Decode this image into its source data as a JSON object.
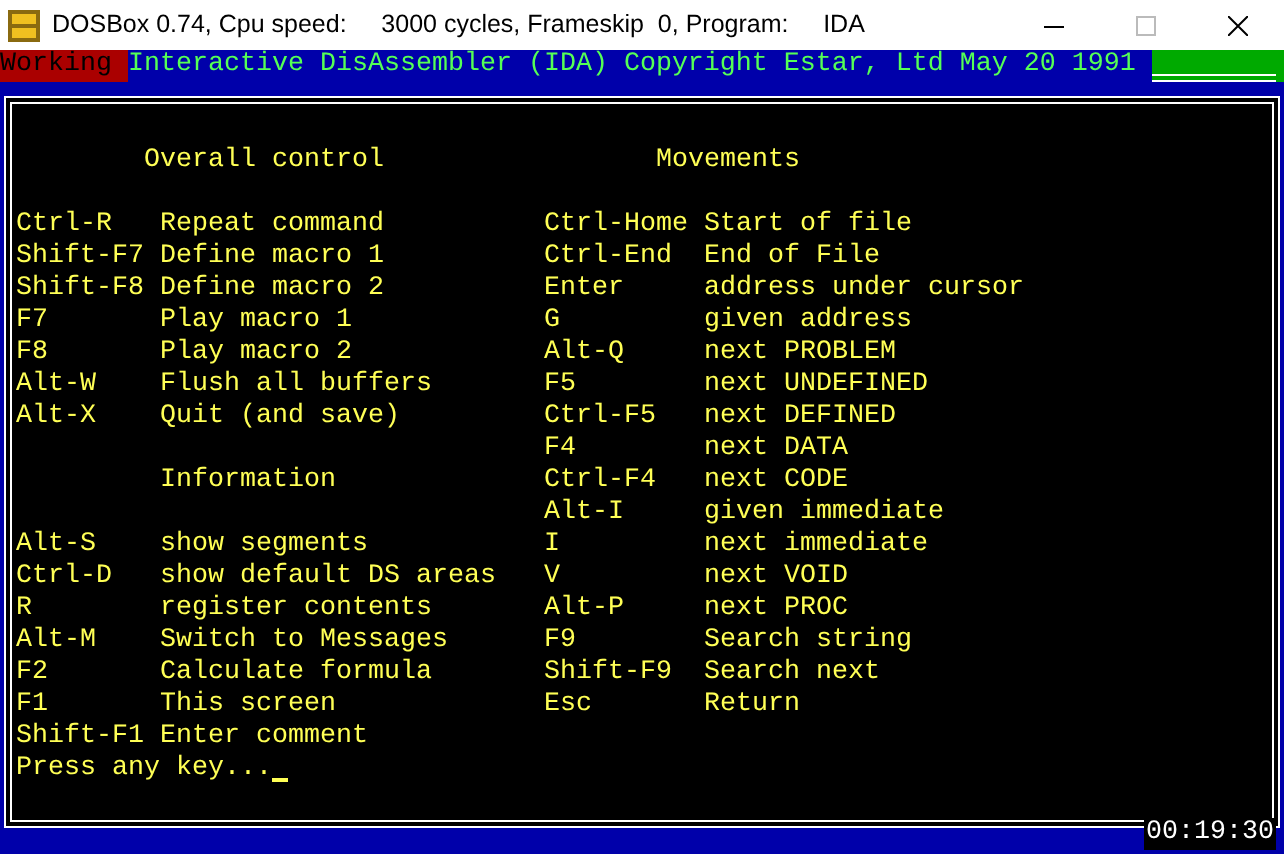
{
  "window": {
    "title": "DOSBox 0.74, Cpu speed:     3000 cycles, Frameskip  0, Program:     IDA"
  },
  "status_bar": {
    "mode": "Working",
    "text": "Interactive DisAssembler (IDA) Copyright Estar, Ltd May 20 1991"
  },
  "help": {
    "left_sections": [
      {
        "heading": "Overall control",
        "items": [
          {
            "key": "Ctrl-R",
            "action": "Repeat command"
          },
          {
            "key": "Shift-F7",
            "action": "Define macro 1"
          },
          {
            "key": "Shift-F8",
            "action": "Define macro 2"
          },
          {
            "key": "F7",
            "action": "Play macro 1"
          },
          {
            "key": "F8",
            "action": "Play macro 2"
          },
          {
            "key": "Alt-W",
            "action": "Flush all buffers"
          },
          {
            "key": "Alt-X",
            "action": "Quit (and save)"
          }
        ]
      },
      {
        "heading": "Information",
        "items": [
          {
            "key": "Alt-S",
            "action": "show segments"
          },
          {
            "key": "Ctrl-D",
            "action": "show default DS areas"
          },
          {
            "key": "R",
            "action": "register contents"
          },
          {
            "key": "Alt-M",
            "action": "Switch to Messages"
          },
          {
            "key": "F2",
            "action": "Calculate formula"
          },
          {
            "key": "F1",
            "action": "This screen"
          },
          {
            "key": "Shift-F1",
            "action": "Enter comment"
          }
        ]
      }
    ],
    "right_section": {
      "heading": "Movements",
      "items": [
        {
          "key": "Ctrl-Home",
          "action": "Start of file"
        },
        {
          "key": "Ctrl-End",
          "action": "End of File"
        },
        {
          "key": "Enter",
          "action": "address under cursor"
        },
        {
          "key": "G",
          "action": "given address"
        },
        {
          "key": "Alt-Q",
          "action": "next PROBLEM"
        },
        {
          "key": "F5",
          "action": "next UNDEFINED"
        },
        {
          "key": "Ctrl-F5",
          "action": "next DEFINED"
        },
        {
          "key": "F4",
          "action": "next DATA"
        },
        {
          "key": "Ctrl-F4",
          "action": "next CODE"
        },
        {
          "key": "Alt-I",
          "action": "given immediate"
        },
        {
          "key": "I",
          "action": "next immediate"
        },
        {
          "key": "V",
          "action": "next VOID"
        },
        {
          "key": "Alt-P",
          "action": "next PROC"
        },
        {
          "key": "F9",
          "action": "Search string"
        },
        {
          "key": "Shift-F9",
          "action": "Search next"
        },
        {
          "key": "Esc",
          "action": "Return"
        }
      ]
    },
    "prompt": "Press any key..."
  },
  "clock": "00:19:30"
}
